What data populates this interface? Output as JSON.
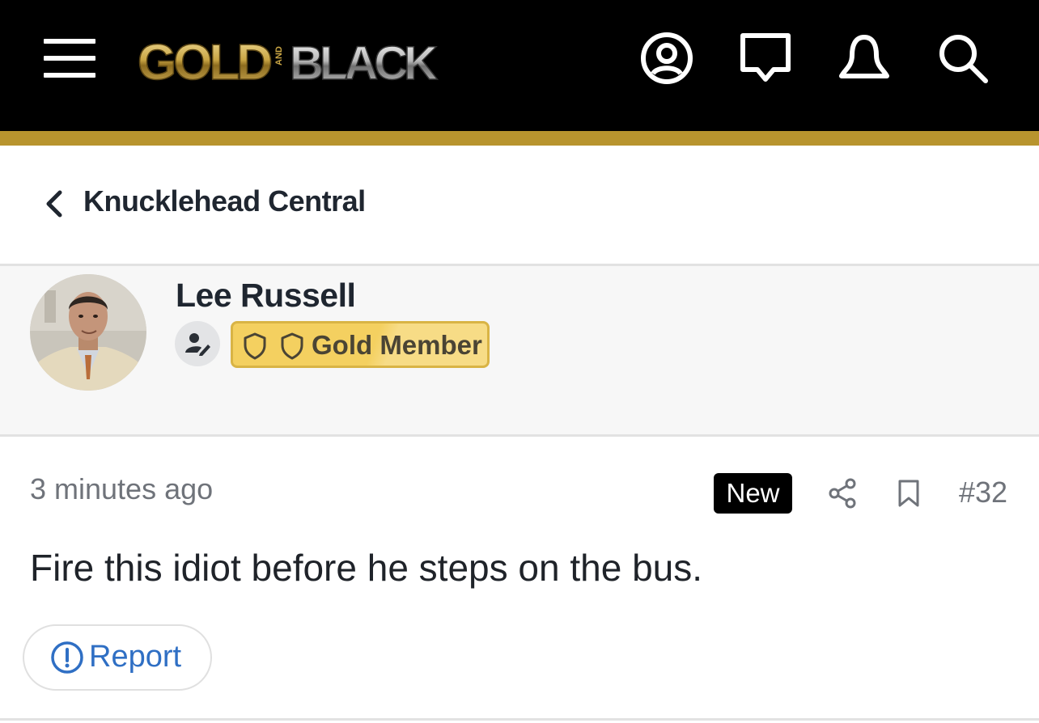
{
  "header": {
    "logo_text": "GOLD AND BLACK",
    "icons": [
      "menu-icon",
      "user-account-icon",
      "messages-icon",
      "notifications-bell-icon",
      "search-icon"
    ],
    "accent_color": "#b8942e",
    "background_color": "#000000"
  },
  "breadcrumb": {
    "back_icon": "chevron-left-icon",
    "label": "Knucklehead Central"
  },
  "post": {
    "author": {
      "name": "Lee Russell",
      "edit_icon": "user-edit-icon",
      "badge_label": "Gold Member",
      "badge_color": "#f4d060"
    },
    "timestamp": "3 minutes ago",
    "new_label": "New",
    "post_number": "#32",
    "body": "Fire this idiot before he steps on the bus.",
    "report_label": "Report",
    "report_color": "#2f6fc4"
  }
}
